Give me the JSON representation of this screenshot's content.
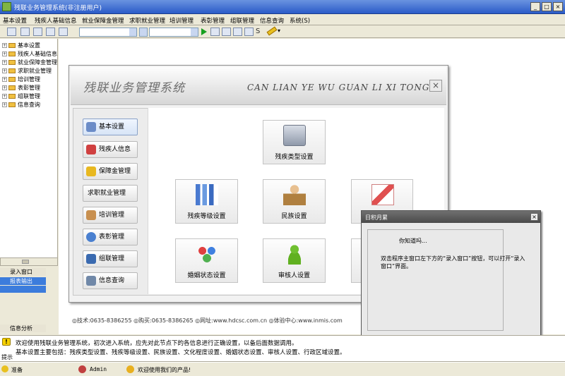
{
  "window": {
    "title": "残联业务管理系统(非注册用户)",
    "min": "_",
    "max": "□",
    "close": "×"
  },
  "menu": [
    "基本设置",
    "残疾人基础信息",
    "就业保障金管理",
    "求职就业管理",
    "培训管理",
    "表彰管理",
    "组联管理",
    "信息查询",
    "系统(S)"
  ],
  "tree": [
    "基本设置",
    "残疾人基础信息",
    "就业保障金管理",
    "求职就业管理",
    "培训管理",
    "表彰管理",
    "组联管理",
    "信息查询"
  ],
  "tree_expand": "+",
  "left_nav": [
    "录入窗口",
    "报表输出",
    "信息分析"
  ],
  "splash": {
    "title_cn": "残联业务管理系统",
    "title_en": "CAN LIAN YE WU GUAN LI XI TONG",
    "close": "×",
    "side_buttons": [
      {
        "label": "基本设置",
        "icon": "monitor-icon",
        "color": "#6b8cc8"
      },
      {
        "label": "残疾人信息",
        "icon": "wheelchair-icon",
        "color": "#d04040"
      },
      {
        "label": "保障金管理",
        "icon": "star-icon",
        "color": "#e8b820"
      },
      {
        "label": "求职就业管理",
        "icon": "",
        "color": ""
      },
      {
        "label": "培训管理",
        "icon": "person-icon",
        "color": "#c89050"
      },
      {
        "label": "表彰管理",
        "icon": "globe-icon",
        "color": "#4a80d0"
      },
      {
        "label": "组联管理",
        "icon": "pen-icon",
        "color": "#3a6ab0"
      },
      {
        "label": "信息查询",
        "icon": "document-icon",
        "color": "#7088a8"
      }
    ],
    "cards": [
      {
        "label": "残疾类型设置",
        "icon": "monitor-icon",
        "color": "#8090a8"
      },
      {
        "label": "残疾等级设置",
        "icon": "bar-chart-icon",
        "color": "#5a8ad0"
      },
      {
        "label": "民族设置",
        "icon": "people-icon",
        "color": "#c8a060"
      },
      {
        "label": "",
        "icon": "envelope-icon",
        "color": "#e05050"
      },
      {
        "label": "婚姻状态设置",
        "icon": "group-icon",
        "color": "#50a050"
      },
      {
        "label": "审核人设置",
        "icon": "user-icon",
        "color": "#60b020"
      }
    ],
    "footer": "◎技术:0635-8386255 ◎购买:0635-8386265 ◎网址:www.hdcsc.com.cn ◎体验中心:www.inmis.com"
  },
  "popup": {
    "title": "日积月累",
    "close": "×",
    "greeting": "你知道吗...",
    "message": "双击程序主窗口左下方的“录入窗口”按钮，可以打开“录入窗口”界面。"
  },
  "statusbox": {
    "tag": "提示",
    "line1": "欢迎使用残联业务管理系统，初次进入系统，应先对此节点下的各信息进行正确设置，以备后面数据调用。",
    "line2": "基本设置主要包括：残疾类型设置、残疾等级设置、民族设置、文化程度设置、婚姻状态设置、审核人设置、行政区域设置。"
  },
  "statusbar": {
    "ready": "准备",
    "user": "Admin",
    "welcome": "欢迎使用我们的产品!"
  }
}
